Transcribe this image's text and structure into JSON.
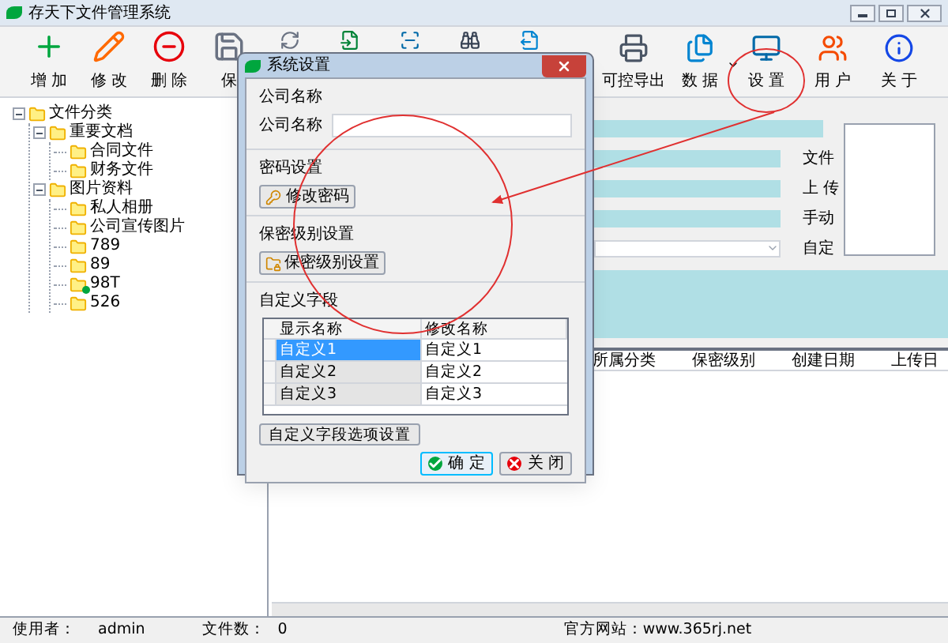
{
  "window": {
    "title": "存天下文件管理系统"
  },
  "toolbar": [
    {
      "kind": "add",
      "label": "增 加"
    },
    {
      "kind": "edit",
      "label": "修 改"
    },
    {
      "kind": "delete",
      "label": "删 除"
    },
    {
      "kind": "save",
      "label": "保"
    },
    {
      "kind": "refresh"
    },
    {
      "kind": "import"
    },
    {
      "kind": "scan"
    },
    {
      "kind": "find"
    },
    {
      "kind": "export"
    },
    {
      "kind": "print",
      "label": "可控导出"
    },
    {
      "kind": "data",
      "label": "数 据",
      "has_menu": true
    },
    {
      "kind": "settings",
      "label": "设 置"
    },
    {
      "kind": "users",
      "label": "用 户"
    },
    {
      "kind": "about",
      "label": "关 于"
    }
  ],
  "tree": [
    {
      "label": "文件分类",
      "expanded": true,
      "children": [
        {
          "label": "重要文档",
          "expanded": true,
          "children": [
            {
              "label": "合同文件"
            },
            {
              "label": "财务文件"
            }
          ]
        },
        {
          "label": "图片资料",
          "expanded": true,
          "children": [
            {
              "label": "私人相册"
            },
            {
              "label": "公司宣传图片"
            },
            {
              "label": "789"
            },
            {
              "label": "89"
            },
            {
              "label": "98T",
              "linked": true
            },
            {
              "label": "526"
            }
          ]
        }
      ]
    }
  ],
  "detail": {
    "labels": [
      "文件",
      "上 传",
      "手动",
      "自定"
    ],
    "columns": [
      "所属分类",
      "保密级别",
      "创建日期",
      "上传日"
    ]
  },
  "dialog": {
    "title": "系统设置",
    "company": {
      "heading": "公司名称",
      "label": "公司名称"
    },
    "password": {
      "heading": "密码设置",
      "button": "修改密码"
    },
    "security": {
      "heading": "保密级别设置",
      "button": "保密级别设置"
    },
    "fields": {
      "heading": "自定义字段",
      "columns": [
        "显示名称",
        "修改名称"
      ],
      "rows": [
        {
          "display": "自定义1",
          "name": "自定义1",
          "selected": true
        },
        {
          "display": "自定义2",
          "name": "自定义2",
          "selected": false
        },
        {
          "display": "自定义3",
          "name": "自定义3",
          "selected": false
        }
      ],
      "options_button": "自定义字段选项设置"
    },
    "ok": "确 定",
    "close": "关 闭"
  },
  "status_bar": {
    "user_label": "使用者：",
    "user": "admin",
    "count_label": "文件数：",
    "count": "0",
    "site": "官方网站：www.365rj.net"
  }
}
